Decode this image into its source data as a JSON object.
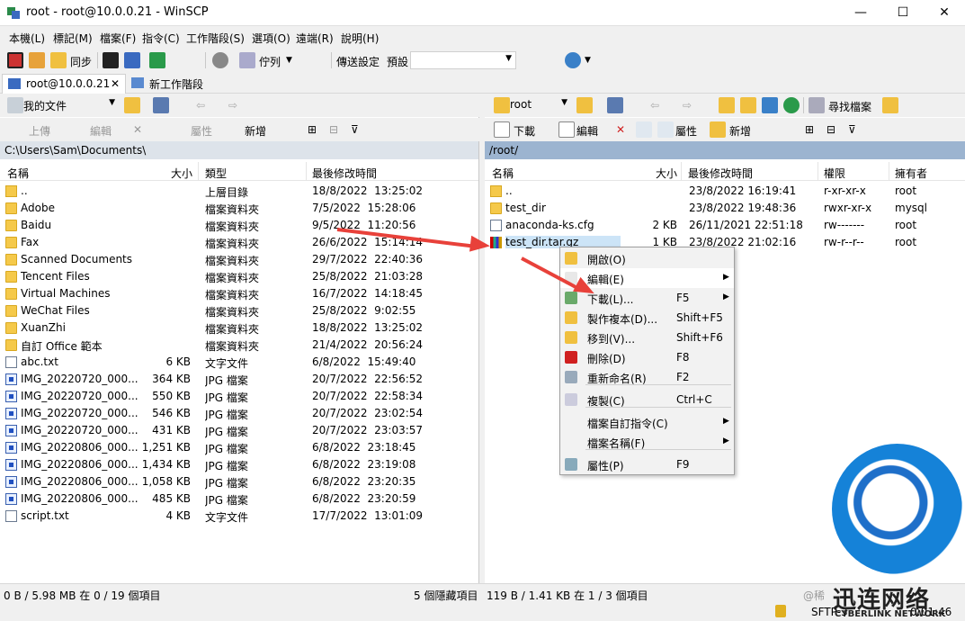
{
  "window": {
    "title": "root - root@10.0.0.21 - WinSCP",
    "minimize": "—",
    "maximize": "☐",
    "close": "✕"
  },
  "menu": [
    "本機(L)",
    "標記(M)",
    "檔案(F)",
    "指令(C)",
    "工作階段(S)",
    "選項(O)",
    "遠端(R)",
    "說明(H)"
  ],
  "toolbar1": {
    "sync_label": "同步",
    "queue_label": "佇列",
    "transfer_label": "傳送設定",
    "transfer_value": "預設"
  },
  "tabs": [
    {
      "label": "root@10.0.0.21",
      "close": "✕"
    },
    {
      "label": "新工作階段"
    }
  ],
  "left": {
    "location": "我的文件",
    "toolbar": {
      "upload": "上傳",
      "edit": "編輯",
      "props": "屬性",
      "new": "新增"
    },
    "path": "C:\\Users\\Sam\\Documents\\",
    "headers": {
      "name": "名稱",
      "size": "大小",
      "type": "類型",
      "mtime": "最後修改時間"
    },
    "rows": [
      {
        "icon": "up",
        "name": "..",
        "size": "",
        "type": "上層目錄",
        "mtime": "18/8/2022  13:25:02"
      },
      {
        "icon": "folder",
        "name": "Adobe",
        "size": "",
        "type": "檔案資料夾",
        "mtime": "7/5/2022  15:28:06"
      },
      {
        "icon": "folder",
        "name": "Baidu",
        "size": "",
        "type": "檔案資料夾",
        "mtime": "9/5/2022  11:20:56"
      },
      {
        "icon": "folder",
        "name": "Fax",
        "size": "",
        "type": "檔案資料夾",
        "mtime": "26/6/2022  15:14:14"
      },
      {
        "icon": "folder",
        "name": "Scanned Documents",
        "size": "",
        "type": "檔案資料夾",
        "mtime": "29/7/2022  22:40:36"
      },
      {
        "icon": "folder",
        "name": "Tencent Files",
        "size": "",
        "type": "檔案資料夾",
        "mtime": "25/8/2022  21:03:28"
      },
      {
        "icon": "folder",
        "name": "Virtual Machines",
        "size": "",
        "type": "檔案資料夾",
        "mtime": "16/7/2022  14:18:45"
      },
      {
        "icon": "folder",
        "name": "WeChat Files",
        "size": "",
        "type": "檔案資料夾",
        "mtime": "25/8/2022  9:02:55"
      },
      {
        "icon": "folder",
        "name": "XuanZhi",
        "size": "",
        "type": "檔案資料夾",
        "mtime": "18/8/2022  13:25:02"
      },
      {
        "icon": "folder",
        "name": "自訂 Office 範本",
        "size": "",
        "type": "檔案資料夾",
        "mtime": "21/4/2022  20:56:24"
      },
      {
        "icon": "doc",
        "name": "abc.txt",
        "size": "6 KB",
        "type": "文字文件",
        "mtime": "6/8/2022  15:49:40"
      },
      {
        "icon": "img",
        "name": "IMG_20220720_000...",
        "size": "364 KB",
        "type": "JPG 檔案",
        "mtime": "20/7/2022  22:56:52"
      },
      {
        "icon": "img",
        "name": "IMG_20220720_000...",
        "size": "550 KB",
        "type": "JPG 檔案",
        "mtime": "20/7/2022  22:58:34"
      },
      {
        "icon": "img",
        "name": "IMG_20220720_000...",
        "size": "546 KB",
        "type": "JPG 檔案",
        "mtime": "20/7/2022  23:02:54"
      },
      {
        "icon": "img",
        "name": "IMG_20220720_000...",
        "size": "431 KB",
        "type": "JPG 檔案",
        "mtime": "20/7/2022  23:03:57"
      },
      {
        "icon": "img",
        "name": "IMG_20220806_000...",
        "size": "1,251 KB",
        "type": "JPG 檔案",
        "mtime": "6/8/2022  23:18:45"
      },
      {
        "icon": "img",
        "name": "IMG_20220806_000...",
        "size": "1,434 KB",
        "type": "JPG 檔案",
        "mtime": "6/8/2022  23:19:08"
      },
      {
        "icon": "img",
        "name": "IMG_20220806_000...",
        "size": "1,058 KB",
        "type": "JPG 檔案",
        "mtime": "6/8/2022  23:20:35"
      },
      {
        "icon": "img",
        "name": "IMG_20220806_000...",
        "size": "485 KB",
        "type": "JPG 檔案",
        "mtime": "6/8/2022  23:20:59"
      },
      {
        "icon": "doc",
        "name": "script.txt",
        "size": "4 KB",
        "type": "文字文件",
        "mtime": "17/7/2022  13:01:09"
      }
    ],
    "status": "0 B / 5.98 MB 在 0 / 19 個項目",
    "hidden": "5 個隱藏項目"
  },
  "right": {
    "location": "root",
    "toolbar": {
      "download": "下載",
      "edit": "編輯",
      "props": "屬性",
      "new": "新增",
      "find": "尋找檔案"
    },
    "path": "/root/",
    "headers": {
      "name": "名稱",
      "size": "大小",
      "mtime": "最後修改時間",
      "perm": "權限",
      "owner": "擁有者"
    },
    "rows": [
      {
        "icon": "up",
        "name": "..",
        "size": "",
        "mtime": "23/8/2022 16:19:41",
        "perm": "r-xr-xr-x",
        "owner": "root"
      },
      {
        "icon": "folder",
        "name": "test_dir",
        "size": "",
        "mtime": "23/8/2022 19:48:36",
        "perm": "rwxr-xr-x",
        "owner": "mysql"
      },
      {
        "icon": "doc",
        "name": "anaconda-ks.cfg",
        "size": "2 KB",
        "mtime": "26/11/2021 22:51:18",
        "perm": "rw-------",
        "owner": "root"
      },
      {
        "icon": "arch",
        "name": "test_dir.tar.gz",
        "size": "1 KB",
        "mtime": "23/8/2022 21:02:16",
        "perm": "rw-r--r--",
        "owner": "root"
      }
    ],
    "status": "119 B / 1.41 KB 在 1 / 3 個項目"
  },
  "context_menu": [
    {
      "label": "開啟(O)",
      "shortcut": "",
      "sub": false,
      "icon": "folder-open-icon"
    },
    {
      "label": "編輯(E)",
      "shortcut": "",
      "sub": true,
      "icon": "edit-icon"
    },
    {
      "label": "下載(L)...",
      "shortcut": "F5",
      "sub": true,
      "icon": "download-icon"
    },
    {
      "label": "製作複本(D)...",
      "shortcut": "Shift+F5",
      "sub": false,
      "icon": "duplicate-icon"
    },
    {
      "label": "移到(V)...",
      "shortcut": "Shift+F6",
      "sub": false,
      "icon": "move-icon"
    },
    {
      "label": "刪除(D)",
      "shortcut": "F8",
      "sub": false,
      "icon": "delete-icon"
    },
    {
      "label": "重新命名(R)",
      "shortcut": "F2",
      "sub": false,
      "icon": "rename-icon"
    },
    {
      "label": "複製(C)",
      "shortcut": "Ctrl+C",
      "sub": false,
      "icon": "copy-icon"
    },
    {
      "label": "檔案自訂指令(C)",
      "shortcut": "",
      "sub": true,
      "icon": ""
    },
    {
      "label": "檔案名稱(F)",
      "shortcut": "",
      "sub": true,
      "icon": ""
    },
    {
      "label": "屬性(P)",
      "shortcut": "F9",
      "sub": false,
      "icon": "properties-icon"
    }
  ],
  "bottom": {
    "sftp": "SFTP-3",
    "time": "0:01:46",
    "watermark_prefix": "@稀"
  },
  "watermark": {
    "cn": "迅连网络",
    "en": "CYBERLINK NETWORK"
  }
}
